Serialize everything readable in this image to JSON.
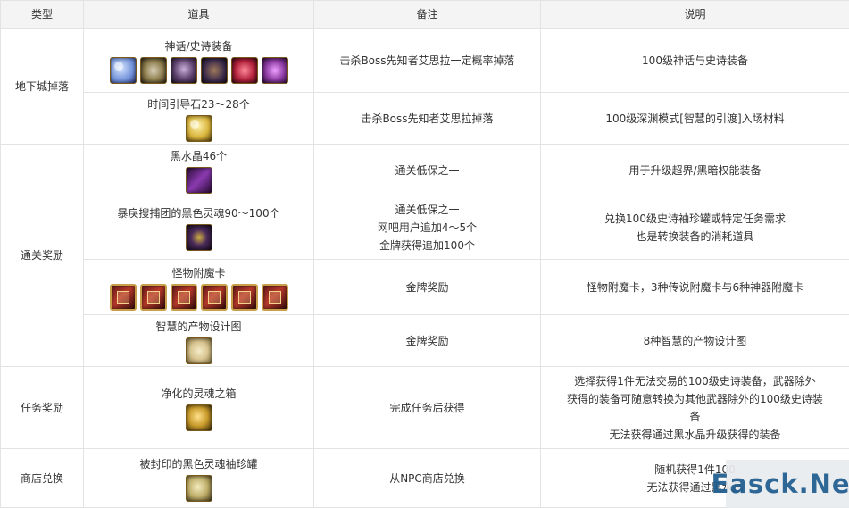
{
  "headers": [
    "类型",
    "道具",
    "备注",
    "说明"
  ],
  "groups": {
    "g1": "地下城掉落",
    "g2": "通关奖励",
    "g3": "任务奖励",
    "g4": "商店兑换"
  },
  "rows": [
    {
      "item": "神话/史诗装备",
      "note": [
        "击杀Boss先知者艾思拉一定概率掉落"
      ],
      "desc": [
        "100级神话与史诗装备"
      ],
      "icons": [
        "mythic-orb-icon",
        "epic-armor-icon",
        "epic-helm-icon",
        "epic-belt-icon",
        "epic-pendant-icon",
        "epic-ring-icon"
      ]
    },
    {
      "item": "时间引导石23～28个",
      "note": [
        "击杀Boss先知者艾思拉掉落"
      ],
      "desc": [
        "100级深渊模式[智慧的引渡]入场材料"
      ],
      "icons": [
        "time-stone-icon"
      ]
    },
    {
      "item": "黑水晶46个",
      "note": [
        "通关低保之一"
      ],
      "desc": [
        "用于升级超界/黑暗权能装备"
      ],
      "icons": [
        "black-crystal-icon"
      ]
    },
    {
      "item": "暴戾搜捕团的黑色灵魂90～100个",
      "note": [
        "通关低保之一",
        "网吧用户追加4～5个",
        "金牌获得追加100个"
      ],
      "desc": [
        "兑换100级史诗袖珍罐或特定任务需求",
        "也是转换装备的消耗道具"
      ],
      "icons": [
        "black-soul-icon"
      ]
    },
    {
      "item": "怪物附魔卡",
      "note": [
        "金牌奖励"
      ],
      "desc": [
        "怪物附魔卡，3种传说附魔卡与6种神器附魔卡"
      ],
      "icons": [
        "card-icon-1",
        "card-icon-2",
        "card-icon-3",
        "card-icon-4",
        "card-icon-5",
        "card-icon-6"
      ]
    },
    {
      "item": "智慧的产物设计图",
      "note": [
        "金牌奖励"
      ],
      "desc": [
        "8种智慧的产物设计图"
      ],
      "icons": [
        "blueprint-icon"
      ]
    },
    {
      "item": "净化的灵魂之箱",
      "note": [
        "完成任务后获得"
      ],
      "desc": [
        "选择获得1件无法交易的100级史诗装备，武器除外",
        "获得的装备可随意转换为其他武器除外的100级史诗装",
        "备",
        "无法获得通过黑水晶升级获得的装备"
      ],
      "icons": [
        "soul-box-icon"
      ]
    },
    {
      "item": "被封印的黑色灵魂袖珍罐",
      "note": [
        "从NPC商店兑换"
      ],
      "desc": [
        "随机获得1件100",
        "无法获得通过黑水晶"
      ],
      "icons": [
        "sealed-jar-icon"
      ]
    }
  ],
  "icon_colors": {
    "mythic-orb-icon": "#6f8fd8",
    "epic-armor-icon": "#8a7a4a",
    "epic-helm-icon": "#5a3f6a",
    "epic-belt-icon": "#3a2a4a",
    "epic-pendant-icon": "#b0203a",
    "epic-ring-icon": "#8a3aa0",
    "time-stone-icon": "#d8b43a",
    "black-crystal-icon": "#8a3ab0",
    "black-soul-icon": "#4a2a5a",
    "blueprint-icon": "#d8c490",
    "soul-box-icon": "#c89a2a",
    "sealed-jar-icon": "#bfae6a"
  },
  "watermark": "Easck.Net"
}
